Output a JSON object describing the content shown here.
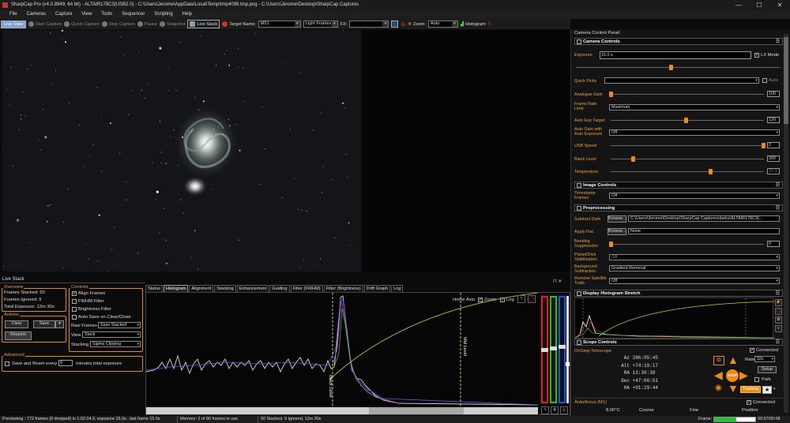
{
  "window": {
    "title": "SharpCap Pro (v4.0.8949, 64 bit) - ALTAIR178C3(USB2.0) - C:\\Users\\Jerome\\AppData\\Local\\Temp\\tmp4098.tmp.png - C:\\Users\\Jerome\\Desktop\\SharpCap Captures",
    "controls": [
      "—",
      "☐",
      "✕"
    ]
  },
  "menu": [
    "File",
    "Cameras",
    "Capture",
    "View",
    "Tools",
    "Sequencer",
    "Scripting",
    "Help"
  ],
  "toolbar": {
    "live_view": "Live View",
    "start_capture": "Start Capture",
    "quick_capture": "Quick Capture",
    "stop_capture": "Stop Capture",
    "pause": "Pause",
    "snapshot": "Snapshot",
    "live_stack": "Live Stack",
    "target_name_label": "Target Name:",
    "target_name_value": "M51",
    "frame_type": "Light Frames",
    "fx_label": "FX:",
    "fx_value": "",
    "zoom_label": "Zoom:",
    "zoom_value": "Auto",
    "histogram": "Histogram"
  },
  "camera_panel": {
    "title": "Camera Control Panel",
    "camera_controls": {
      "header": "Camera Controls",
      "exposure_label": "Exposure",
      "exposure_value": "15.0 s",
      "lx_mode": "LX Mode",
      "quick_picks": "Quick Picks",
      "auto": "Auto",
      "analogue_gain_label": "Analogue Gain",
      "analogue_gain_value": "100",
      "frame_rate_label": "Frame Rate Limit",
      "frame_rate_value": "Maximum",
      "auto_exp_target_label": "Auto Exp Target",
      "auto_exp_target_value": "120",
      "auto_gain_label": "Auto Gain with Auto Exposure",
      "auto_gain_value": "Off",
      "usb_speed_label": "USB Speed",
      "usb_speed_value": "2",
      "black_level_label": "Black Level",
      "black_level_value": "300",
      "temperature_label": "Temperature",
      "temperature_value": "15.3"
    },
    "image_controls": {
      "header": "Image Controls",
      "timestamp_label": "Timestamp Frames",
      "timestamp_value": "Off"
    },
    "preprocessing": {
      "header": "Preprocessing",
      "subtract_dark_label": "Subtract Dark",
      "browse": "Browse...",
      "dark_path": "C:\\Users\\Jerome\\Desktop\\SharpCap Captures\\darks\\ALTAIR178C3(...",
      "apply_flat_label": "Apply Flat",
      "flat_value": "None",
      "banding_label": "Banding Suppression",
      "banding_value": "0",
      "planet_label": "Planet/Disk Stabilization",
      "planet_value": "Off",
      "bg_sub_label": "Background Subtraction",
      "bg_sub_value": "Gradient Removal",
      "sat_trails_label": "Remove Satellite Trails",
      "sat_trails_value": "Off"
    },
    "display_histogram": {
      "header": "Display Histogram Stretch"
    },
    "scope_controls": {
      "header": "Scope Controls",
      "connected": "Connected",
      "telescope": "OnStep Telescope",
      "az_label": "Az",
      "az_value": "286:05:45",
      "alt_label": "Alt",
      "alt_value": "+74:19:17",
      "ra_label": "RA",
      "ra_value": "13:30:38",
      "dec_label": "Dec",
      "dec_value": "+47:06:51",
      "ha_label": "HA",
      "ha_value": "+01:29:44",
      "rate_label": "Rate",
      "rate_value": "32x",
      "setup": "Setup",
      "park": "Park",
      "tracking": "Tracking",
      "stop": "STOP"
    },
    "focuser": {
      "name": "Arduifocus (M1)",
      "connected": "Connected",
      "temperature": "8.00°C",
      "coarse": "Coarse",
      "fine": "Fine",
      "position": "Position",
      "frame_label": "Frame:",
      "frame_time": "00:07/00:08"
    }
  },
  "live_stack": {
    "title": "Live Stack",
    "overview_label": "Overview",
    "frames_stacked": "Frames Stacked: 50",
    "frames_ignored": "Frames Ignored: 9",
    "total_exposure": "Total Exposure: 12m 30s",
    "actions_label": "Actions",
    "clear": "Clear",
    "save": "Save",
    "resume": "Resume",
    "controls_label": "Controls",
    "align_frames": "Align Frames",
    "fwhm_filter": "FWHM Filter",
    "brightness_filter": "Brightness Filter",
    "auto_save": "Auto Save on Clear/Close",
    "raw_frames_label": "Raw Frames",
    "raw_frames_value": "Save Stacked",
    "view_label": "View",
    "view_value": "Stack",
    "stacking_label": "Stacking",
    "stacking_value": "Sigma Clipping",
    "advanced_label": "Advanced",
    "save_reset": "Save and Reset every",
    "save_reset_num": "0",
    "minutes_text": "minutes total exposure"
  },
  "tabs": [
    "Status",
    "Histogram",
    "Alignment",
    "Stacking",
    "Enhancement",
    "Guiding",
    "Filter (FWHM)",
    "Filter (Brightness)",
    "Drift Graph",
    "Log"
  ],
  "histogram": {
    "home": "Home",
    "axis": "Axis:",
    "zoom": "Zoom",
    "log": "Log",
    "black_level": "Black Level",
    "mid_level": "Mid Level"
  },
  "status": {
    "previewing": "Previewing : 772 frames (0 dropped) in 1:02:34.9, exposure 15.0s , last frame 15.0s",
    "memory": "Memory: 2 of 86 frames in use.",
    "stacked": "50 Stacked, 9 Ignored, 12m 30s"
  },
  "colors": {
    "accent": "#ee8a1a",
    "label": "#e8a040"
  }
}
